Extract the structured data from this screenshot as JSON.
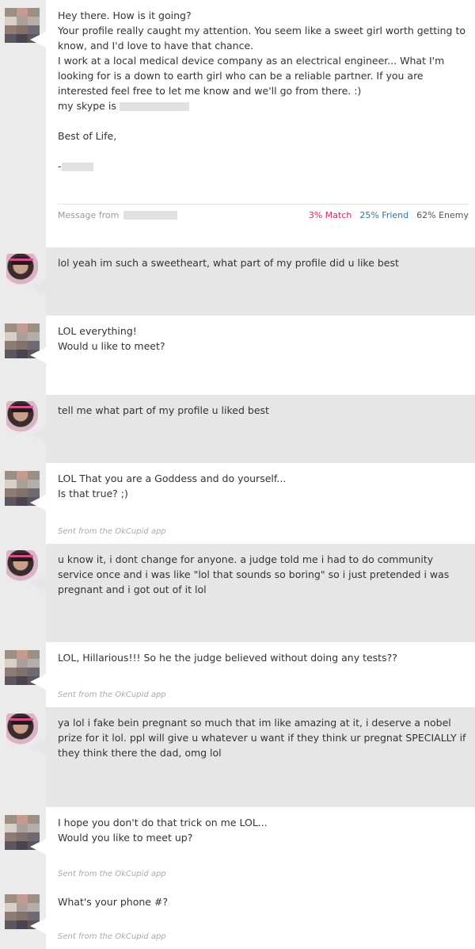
{
  "messages": [
    {
      "sender": "them",
      "lines": [
        "Hey there. How is it going?",
        "Your profile really caught my attention. You seem like a sweet girl worth getting to know, and I'd love to have that chance.",
        "I work at a local medical device company as an electrical engineer... What I'm looking for is a down to earth girl who can be a reliable partner. If you are interested feel free to let me know and we'll go from there. :)"
      ],
      "skype_label": "my skype is",
      "signoff": "Best of Life,",
      "dash": "-",
      "footer": {
        "from_label": "Message from",
        "match": "3% Match",
        "friend": "25% Friend",
        "enemy": "62% Enemy"
      }
    },
    {
      "sender": "me",
      "text": "lol yeah im such a sweetheart, what part of my profile did u like best"
    },
    {
      "sender": "them",
      "text": "LOL everything!\nWould u like to meet?"
    },
    {
      "sender": "me",
      "text": "tell me what part of my profile u liked best"
    },
    {
      "sender": "them",
      "text": "LOL That you are a Goddess and do yourself...\nIs that true? ;)",
      "sent_from": "Sent from the OkCupid app"
    },
    {
      "sender": "me",
      "text": "u know it, i dont change for anyone. a judge told me i had to do community service once and i was like \"lol that sounds so boring\" so i just pretended i was pregnant and i got out of it lol"
    },
    {
      "sender": "them",
      "text": "LOL, Hillarious!!! So he the judge believed without doing any tests??",
      "sent_from": "Sent from the OkCupid app"
    },
    {
      "sender": "me",
      "text": "ya lol i fake bein pregnant so much that im like amazing at it, i deserve a nobel prize for it lol. ppl will give u whatever u want if they think ur pregnat SPECIALLY if they think there the dad, omg lol"
    },
    {
      "sender": "them",
      "text": "I hope you don't do that trick on me LOL...\nWould you like to meet up?",
      "sent_from": "Sent from the OkCupid app"
    },
    {
      "sender": "them",
      "text": "What's your phone #?",
      "sent_from": "Sent from the OkCupid app"
    }
  ]
}
